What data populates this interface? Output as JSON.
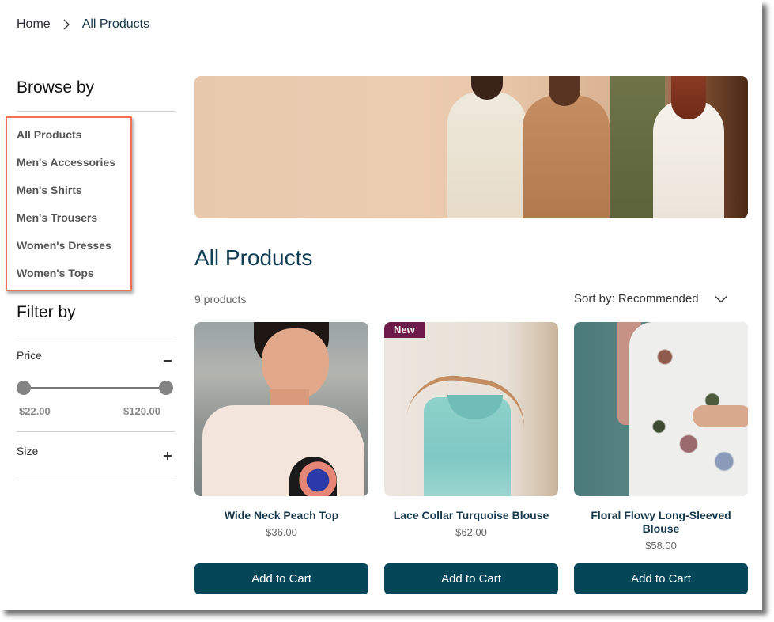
{
  "breadcrumb": {
    "items": [
      "Home",
      "All Products"
    ]
  },
  "sidebar": {
    "browse_title": "Browse by",
    "categories": [
      "All Products",
      "Men's Accessories",
      "Men's Shirts",
      "Men's Trousers",
      "Women's Dresses",
      "Women's Tops"
    ],
    "filter_title": "Filter by",
    "filters": {
      "price": {
        "label": "Price",
        "toggle": "collapse",
        "min": "$22.00",
        "max": "$120.00",
        "selected_min_fraction": 0,
        "selected_max_fraction": 1
      },
      "size": {
        "label": "Size",
        "toggle": "expand"
      }
    }
  },
  "main": {
    "title": "All Products",
    "product_count": "9 products",
    "sort_label": "Sort by: Recommended",
    "products": [
      {
        "name": "Wide Neck Peach Top",
        "price": "$36.00",
        "badge": null,
        "button": "Add to Cart"
      },
      {
        "name": "Lace Collar Turquoise Blouse",
        "price": "$62.00",
        "badge": "New",
        "button": "Add to Cart"
      },
      {
        "name": "Floral Flowy Long-Sleeved Blouse",
        "price": "$58.00",
        "badge": null,
        "button": "Add to Cart"
      }
    ]
  },
  "colors": {
    "accent": "#054759",
    "title": "#0e3d55",
    "badge": "#6b1a4a",
    "highlight": "#f26f55"
  }
}
